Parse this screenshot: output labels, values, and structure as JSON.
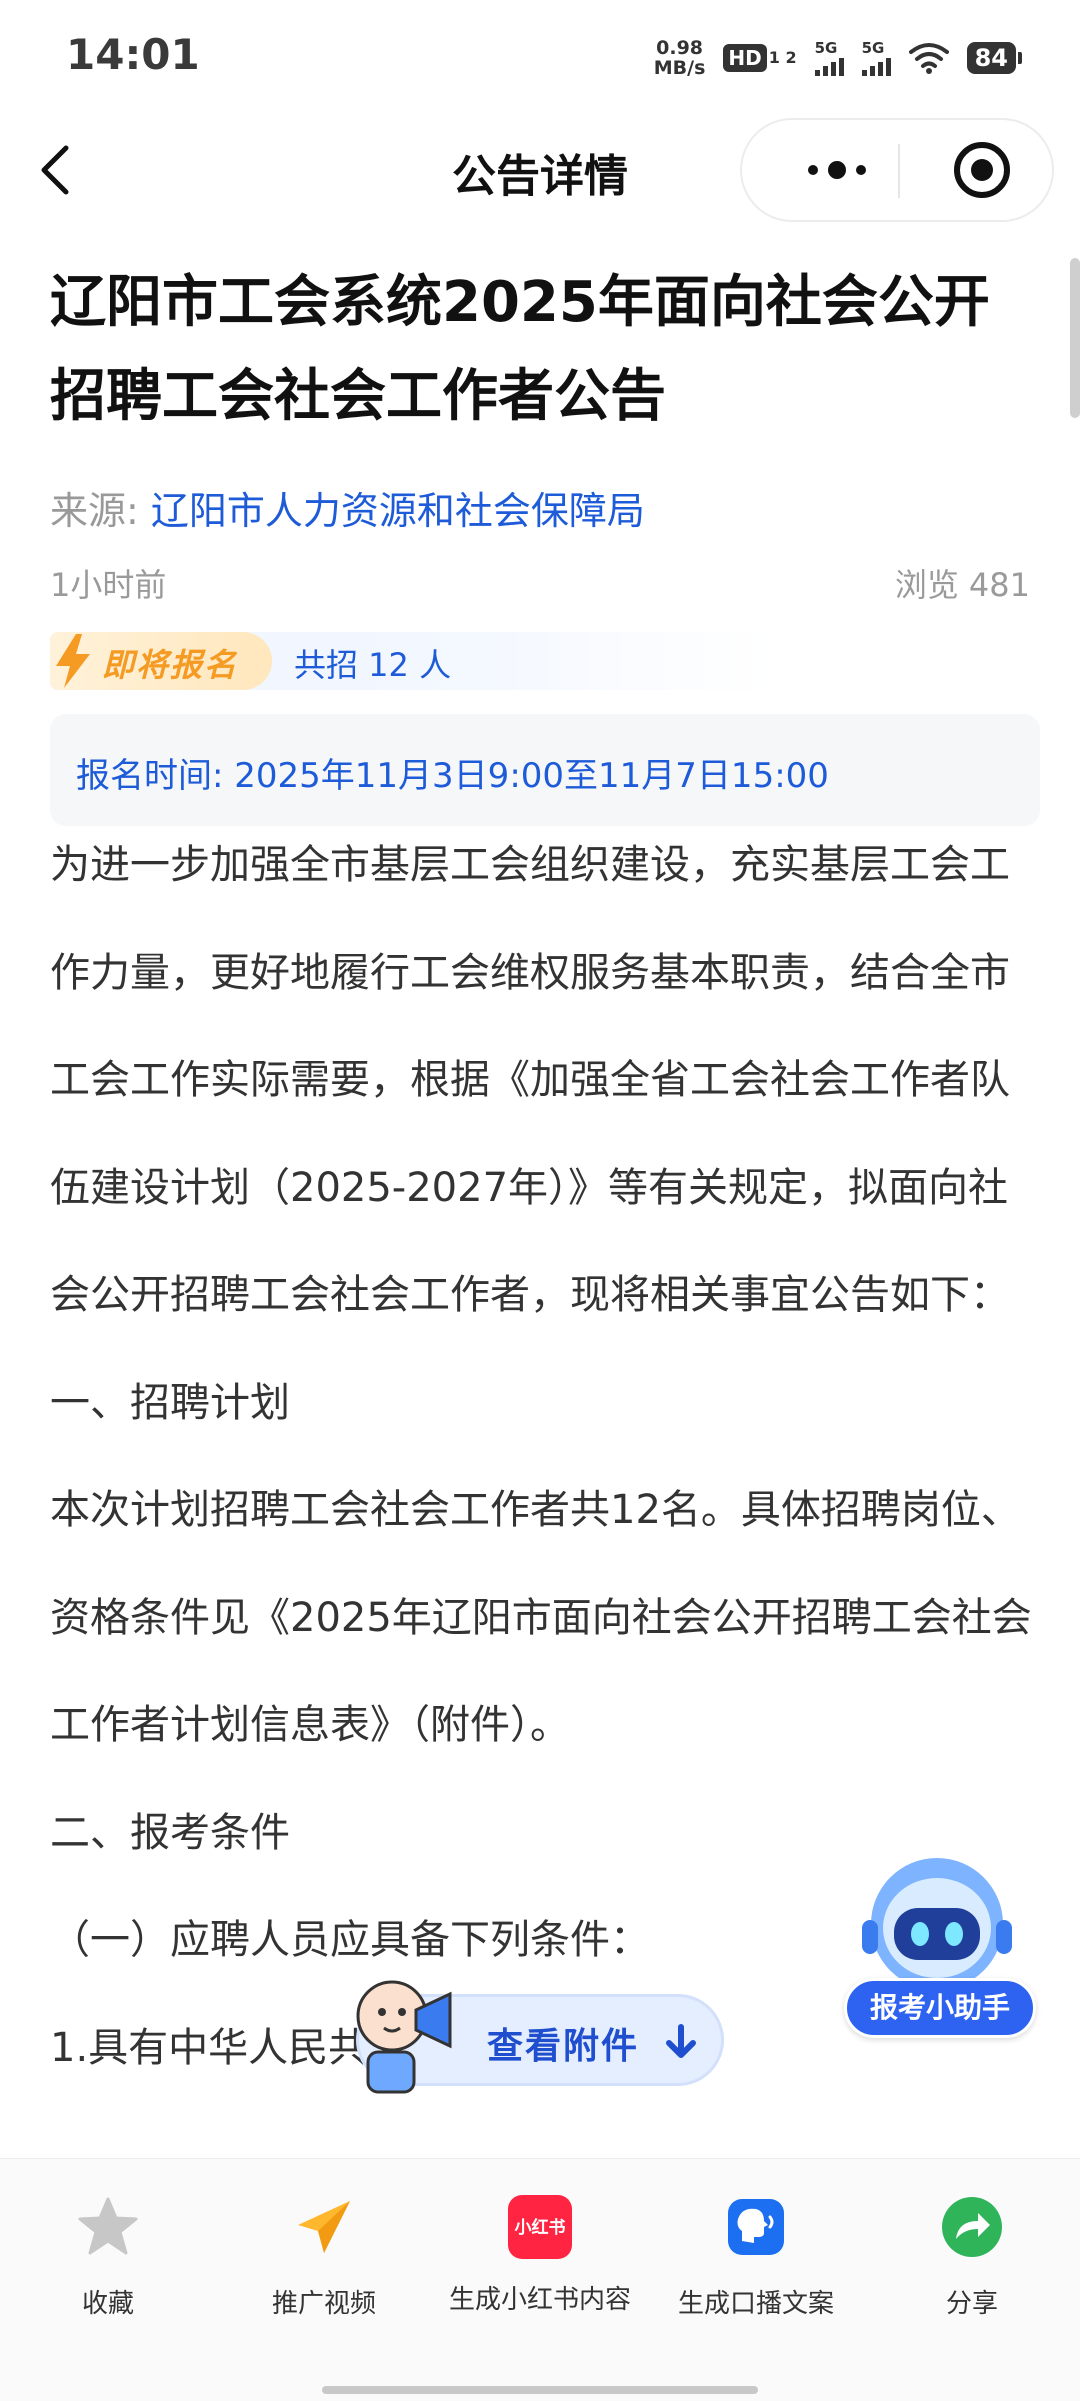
{
  "status_bar": {
    "time": "14:01",
    "net_speed_value": "0.98",
    "net_speed_unit": "MB/s",
    "hd_label": "HD",
    "hd_sub": "1 2",
    "signal1_label": "5G",
    "signal2_label": "5G",
    "battery": "84"
  },
  "nav": {
    "title": "公告详情"
  },
  "article": {
    "title": "辽阳市工会系统2025年面向社会公开招聘工会社会工作者公告",
    "source_label": "来源:",
    "source_value": "辽阳市人力资源和社会保障局",
    "time_ago": "1小时前",
    "views_label": "浏览",
    "views_count": "481",
    "status_badge": "即将报名",
    "hire_count": "共招 12 人",
    "registration_time": "报名时间: 2025年11月3日9:00至11月7日15:00",
    "paragraphs": [
      "为进一步加强全市基层工会组织建设，充实基层工会工作力量，更好地履行工会维权服务基本职责，结合全市工会工作实际需要，根据《加强全省工会社会工作者队伍建设计划（2025-2027年）》等有关规定，拟面向社会公开招聘工会社会工作者，现将相关事宜公告如下：",
      "一、招聘计划",
      "本次计划招聘工会社会工作者共12名。具体招聘岗位、资格条件见《2025年辽阳市面向社会公开招聘工会社会工作者计划信息表》（附件）。",
      "二、报考条件",
      "（一）应聘人员应具备下列条件：",
      "1.具有中华人民共和国国籍；"
    ]
  },
  "floating": {
    "assistant_label": "报考小助手",
    "attachment_label": "查看附件"
  },
  "toolbar": {
    "items": [
      {
        "label": "收藏",
        "icon": "star-icon"
      },
      {
        "label": "推广视频",
        "icon": "paper-plane-icon"
      },
      {
        "label": "生成小红书内容",
        "icon": "xiaohongshu-icon",
        "icon_text": "小红书"
      },
      {
        "label": "生成口播文案",
        "icon": "speaking-head-icon"
      },
      {
        "label": "分享",
        "icon": "share-icon"
      }
    ]
  },
  "colors": {
    "accent_blue": "#1e5bd8",
    "badge_orange": "#f59a23",
    "share_green": "#2fb45a",
    "xhs_red": "#ff2442"
  }
}
